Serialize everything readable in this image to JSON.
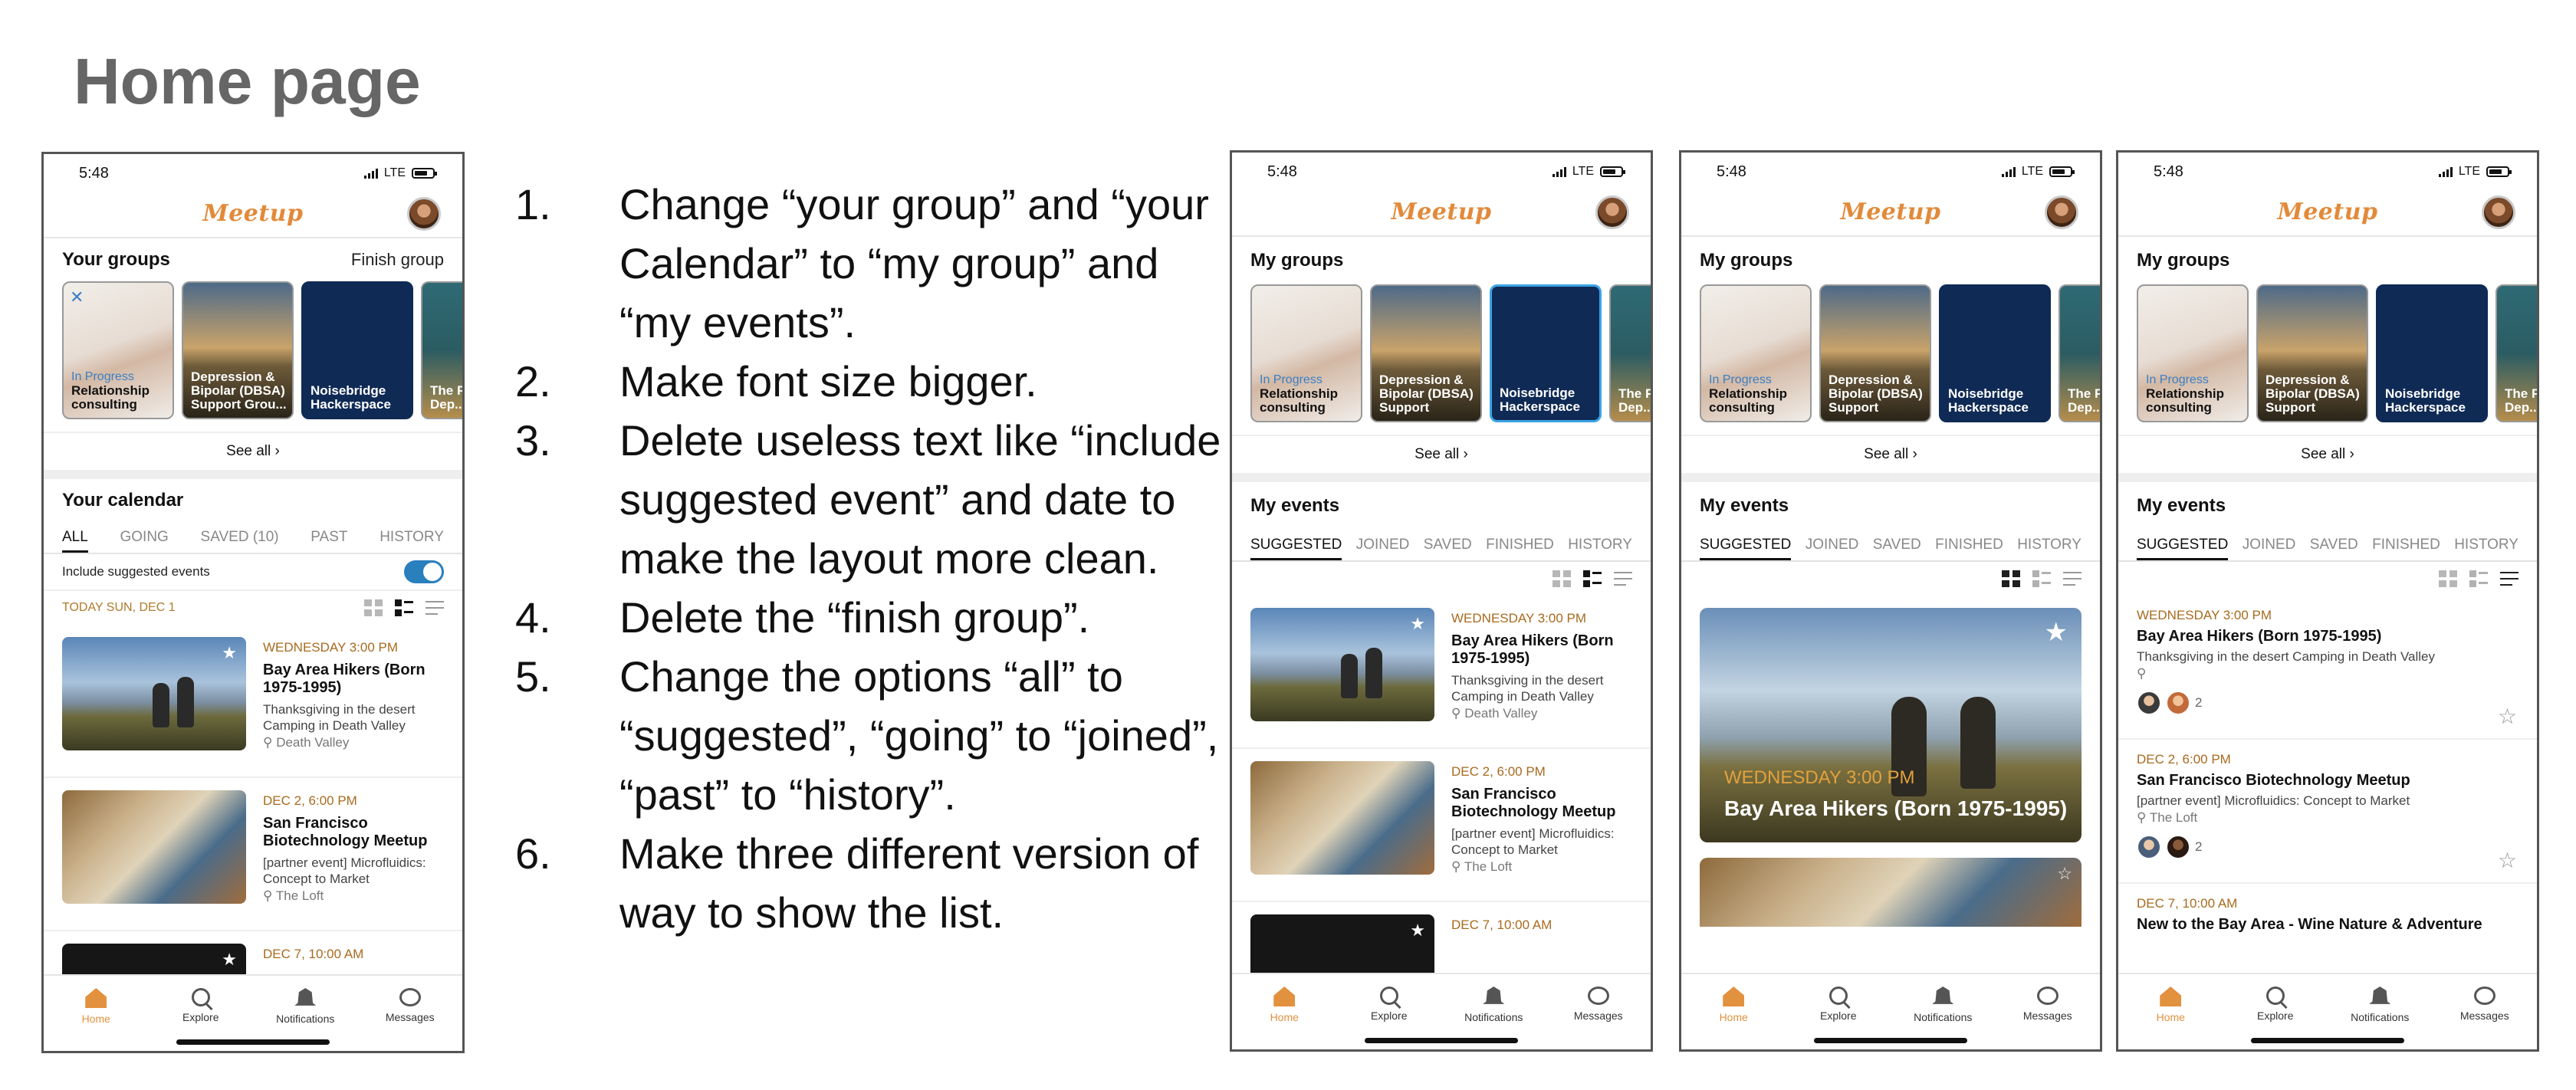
{
  "slide": {
    "title": "Home page",
    "notes": [
      {
        "num": "1.",
        "text": "Change “your group” and “your Calendar” to “my group” and “my events”."
      },
      {
        "num": "2.",
        "text": "Make font size bigger."
      },
      {
        "num": "3.",
        "text": "Delete useless text like “include suggested event” and date to make the layout more clean."
      },
      {
        "num": "4.",
        "text": "Delete the “finish group”."
      },
      {
        "num": "5.",
        "text": "Change the options “all” to “suggested”, “going” to “joined”, “past” to “history”."
      },
      {
        "num": "6.",
        "text": "Make three different version of way to show the list."
      }
    ]
  },
  "status": {
    "time": "5:48",
    "network": "LTE"
  },
  "logo": "Meetup",
  "before": {
    "groups_title": "Your groups",
    "finish_group": "Finish group",
    "groups": [
      {
        "status": "In Progress",
        "name": "Relationship consulting"
      },
      {
        "name": "Depression & Bipolar (DBSA) Support Grou..."
      },
      {
        "name": "Noisebridge Hackerspace"
      },
      {
        "name": "The Fra... Dep..."
      }
    ],
    "see_all": "See all ›",
    "calendar_title": "Your calendar",
    "tabs": [
      "ALL",
      "GOING",
      "SAVED (10)",
      "PAST",
      "HISTORY"
    ],
    "toggle_label": "Include suggested events",
    "today_label": "TODAY  SUN, DEC 1",
    "events": [
      {
        "date": "WEDNESDAY 3:00 PM",
        "title": "Bay Area Hikers (Born 1975-1995)",
        "desc": "Thanksgiving in the desert Camping in Death Valley",
        "loc": "Death Valley"
      },
      {
        "date": "DEC 2, 6:00 PM",
        "title": "San Francisco Biotechnology Meetup",
        "desc": "[partner event] Microfluidics: Concept to Market",
        "loc": "The Loft"
      },
      {
        "date": "DEC 7, 10:00 AM"
      }
    ]
  },
  "after": {
    "groups_title": "My groups",
    "groups": [
      {
        "status": "In Progress",
        "name": "Relationship consulting"
      },
      {
        "name": "Depression & Bipolar (DBSA) Support"
      },
      {
        "name": "Noisebridge Hackerspace"
      },
      {
        "name": "The Fra... Dep..."
      }
    ],
    "see_all": "See all ›",
    "events_title": "My events",
    "tabs": [
      "SUGGESTED",
      "JOINED",
      "SAVED",
      "FINISHED",
      "HISTORY"
    ],
    "events": [
      {
        "date": "WEDNESDAY 3:00 PM",
        "title": "Bay Area Hikers (Born 1975-1995)",
        "desc": "Thanksgiving in the desert Camping in Death Valley",
        "loc": "Death Valley",
        "attendee_count": "2"
      },
      {
        "date": "DEC 2, 6:00 PM",
        "title": "San Francisco Biotechnology Meetup",
        "desc": "[partner event] Microfluidics: Concept to Market",
        "loc": "The Loft",
        "attendee_count": "2"
      },
      {
        "date": "DEC 7, 10:00 AM",
        "title": "New to the Bay Area - Wine Nature & Adventure"
      }
    ]
  },
  "nav": [
    "Home",
    "Explore",
    "Notifications",
    "Messages"
  ],
  "colors": {
    "accent": "#e2913f",
    "date": "#a86a1e",
    "toggle": "#2a7fbd"
  }
}
